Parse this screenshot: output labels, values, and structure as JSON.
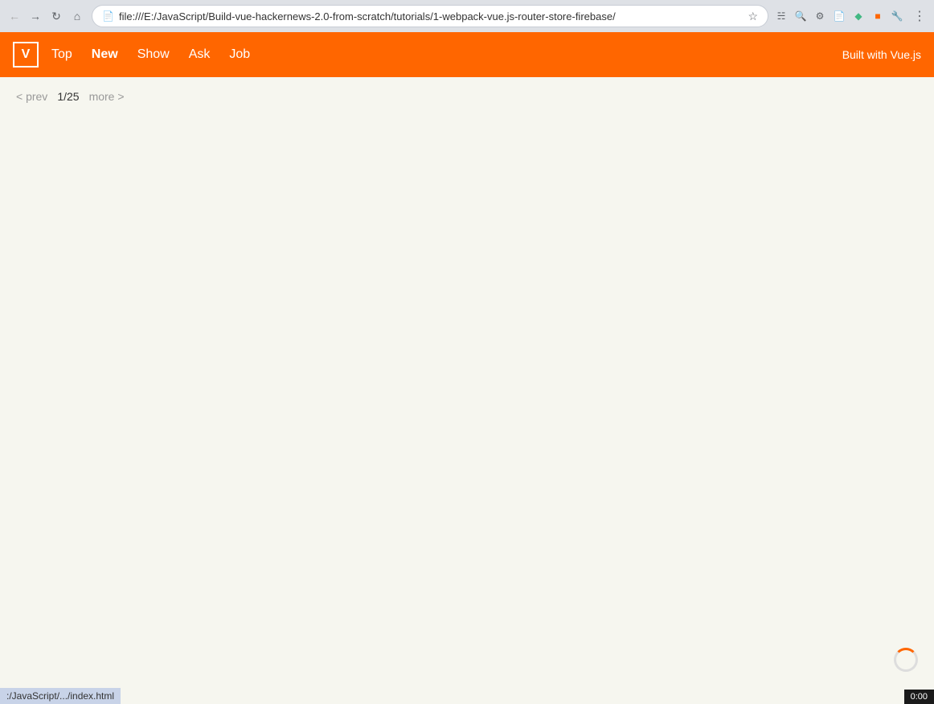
{
  "browser": {
    "url": "file:///E:/JavaScript/Build-vue-hackernews-2.0-from-scratch/tutorials/1-webpack-vue.js-router-store-firebase/",
    "status_bar_text": ":/JavaScript/.../index.html",
    "time": "0:00"
  },
  "navbar": {
    "logo_letter": "V",
    "links": [
      {
        "label": "Top",
        "active": false
      },
      {
        "label": "New",
        "active": true
      },
      {
        "label": "Show",
        "active": false
      },
      {
        "label": "Ask",
        "active": false
      },
      {
        "label": "Job",
        "active": false
      }
    ],
    "right_text": "Built with Vue.js"
  },
  "pagination": {
    "prev_label": "< prev",
    "page_info": "1/25",
    "more_label": "more >"
  }
}
